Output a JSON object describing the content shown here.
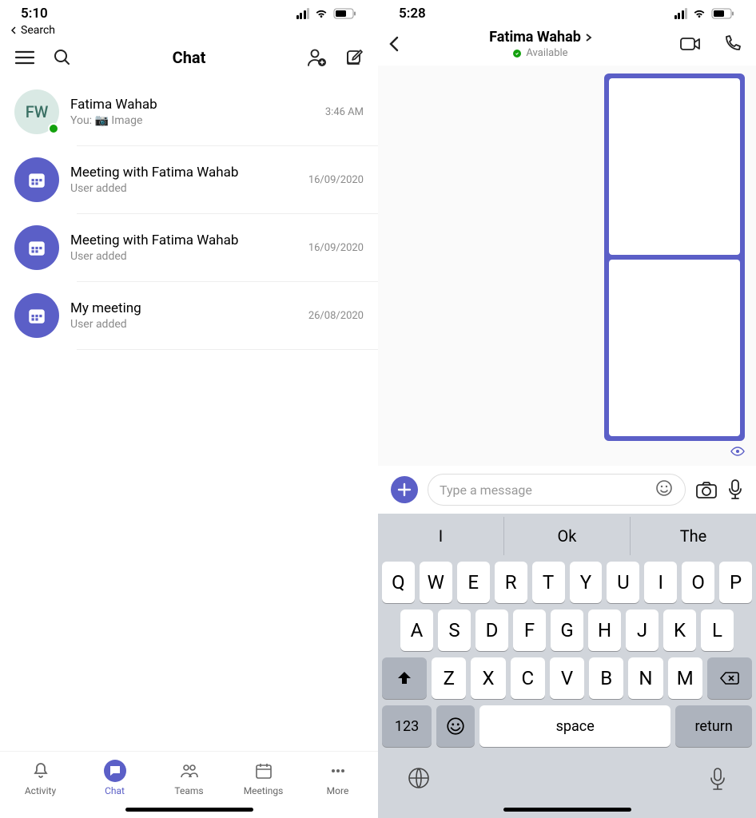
{
  "left": {
    "status_time": "5:10",
    "back_search": "Search",
    "header_title": "Chat",
    "chats": [
      {
        "initials": "FW",
        "title": "Fatima Wahab",
        "sub": "You: 📷 Image",
        "time": "3:46 AM",
        "type": "person"
      },
      {
        "title": "Meeting with Fatima Wahab",
        "sub": "User added",
        "time": "16/09/2020",
        "type": "meeting"
      },
      {
        "title": "Meeting with Fatima Wahab",
        "sub": "User added",
        "time": "16/09/2020",
        "type": "meeting"
      },
      {
        "title": "My meeting",
        "sub": "User added",
        "time": "26/08/2020",
        "type": "meeting"
      }
    ],
    "nav": {
      "activity": "Activity",
      "chat": "Chat",
      "teams": "Teams",
      "meetings": "Meetings",
      "more": "More"
    }
  },
  "right": {
    "status_time": "5:28",
    "title": "Fatima Wahab",
    "presence": "Available",
    "placeholder": "Type a message"
  },
  "keyboard": {
    "suggestions": [
      "I",
      "Ok",
      "The"
    ],
    "row1": [
      "Q",
      "W",
      "E",
      "R",
      "T",
      "Y",
      "U",
      "I",
      "O",
      "P"
    ],
    "row2": [
      "A",
      "S",
      "D",
      "F",
      "G",
      "H",
      "J",
      "K",
      "L"
    ],
    "row3": [
      "Z",
      "X",
      "C",
      "V",
      "B",
      "N",
      "M"
    ],
    "num": "123",
    "space": "space",
    "return": "return"
  }
}
